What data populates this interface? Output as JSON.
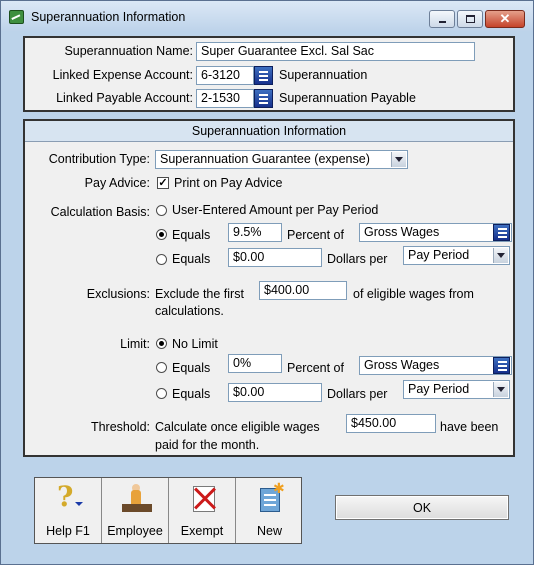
{
  "window": {
    "title": "Superannuation Information",
    "icons": {
      "app": "app-icon",
      "minimize": "minimize-icon",
      "maximize": "maximize-icon",
      "close": "close-icon"
    },
    "close_glyph": "✕"
  },
  "top": {
    "name_label": "Superannuation Name:",
    "name_value": "Super Guarantee Excl. Sal Sac",
    "expense_label": "Linked Expense Account:",
    "expense_value": "6-3120",
    "expense_name": "Superannuation",
    "payable_label": "Linked Payable Account:",
    "payable_value": "2-1530",
    "payable_name": "Superannuation Payable"
  },
  "section": {
    "header": "Superannuation Information",
    "contribution_label": "Contribution Type:",
    "contribution_value": "Superannuation Guarantee (expense)",
    "payadvice_label": "Pay Advice:",
    "payadvice_checked": true,
    "payadvice_check_glyph": "✓",
    "payadvice_text": "Print on Pay Advice",
    "calc_label": "Calculation Basis:",
    "calc_opt1": "User-Entered Amount per Pay Period",
    "calc_opt2": "Equals",
    "calc_percent_value": "9.5%",
    "calc_percent_of": "Percent of",
    "calc_percent_base": "Gross Wages",
    "calc_opt3": "Equals",
    "calc_dollars_value": "$0.00",
    "calc_dollars_per": "Dollars per",
    "calc_dollars_period": "Pay Period",
    "calc_selected": "percent",
    "excl_label": "Exclusions:",
    "excl_text1": "Exclude the first",
    "excl_value": "$400.00",
    "excl_text2": "of eligible wages from",
    "excl_text3": "calculations.",
    "limit_label": "Limit:",
    "limit_opt1": "No Limit",
    "limit_opt2": "Equals",
    "limit_percent_value": "0%",
    "limit_percent_of": "Percent of",
    "limit_percent_base": "Gross Wages",
    "limit_opt3": "Equals",
    "limit_dollars_value": "$0.00",
    "limit_dollars_per": "Dollars per",
    "limit_dollars_period": "Pay Period",
    "limit_selected": "none",
    "thresh_label": "Threshold:",
    "thresh_text1": "Calculate once eligible wages",
    "thresh_value": "$450.00",
    "thresh_text2": "have been",
    "thresh_text3": "paid for the month."
  },
  "toolbar": {
    "help_label": "Help F1",
    "help_glyph": "?",
    "employee_label": "Employee",
    "exempt_label": "Exempt",
    "new_label": "New",
    "new_star": "✱",
    "icons": [
      "help-icon",
      "employee-icon",
      "exempt-icon",
      "new-icon"
    ]
  },
  "ok_label": "OK",
  "colors": {
    "lookup": "#1c3a9a",
    "section_header": "#d7e4f1",
    "window_frame": "#bcd3ea"
  }
}
